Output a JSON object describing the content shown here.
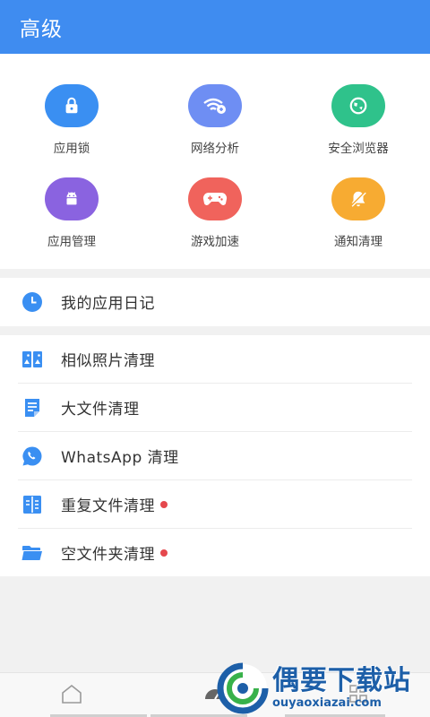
{
  "header": {
    "title": "高级"
  },
  "tools": [
    {
      "label": "应用锁",
      "icon": "lock-icon",
      "color": "#3a8ff2"
    },
    {
      "label": "网络分析",
      "icon": "wifi-icon",
      "color": "#6e8ef3"
    },
    {
      "label": "安全浏览器",
      "icon": "globe-icon",
      "color": "#2fc28b"
    },
    {
      "label": "应用管理",
      "icon": "android-icon",
      "color": "#8a63e0"
    },
    {
      "label": "游戏加速",
      "icon": "gamepad-icon",
      "color": "#f0635c"
    },
    {
      "label": "通知清理",
      "icon": "bell-off-icon",
      "color": "#f7ab32"
    }
  ],
  "diary": {
    "label": "我的应用日记",
    "icon": "clock-icon"
  },
  "list": [
    {
      "label": "相似照片清理",
      "icon": "photos-icon",
      "badge": false
    },
    {
      "label": "大文件清理",
      "icon": "file-icon",
      "badge": false
    },
    {
      "label": "WhatsApp 清理",
      "icon": "whatsapp-icon",
      "badge": false
    },
    {
      "label": "重复文件清理",
      "icon": "duplicate-icon",
      "badge": true
    },
    {
      "label": "空文件夹清理",
      "icon": "folder-icon",
      "badge": true
    }
  ],
  "colors": {
    "accent": "#3f8cf0",
    "badge": "#e5484d"
  },
  "watermark": {
    "name": "偶要下载站",
    "domain": "ouyaoxiazai.com"
  }
}
